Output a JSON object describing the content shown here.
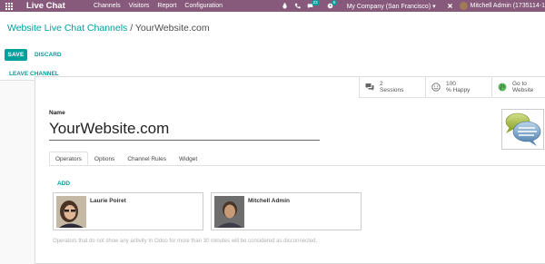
{
  "navbar": {
    "brand": "Live Chat",
    "menu": [
      "Channels",
      "Visitors",
      "Report",
      "Configuration"
    ],
    "messages_badge": "23",
    "activities_badge": "6",
    "company": "My Company (San Francisco)",
    "user": "Mitchell Admin (1735114-1"
  },
  "breadcrumb": {
    "parent": "Website Live Chat Channels",
    "separator": "/",
    "current": "YourWebsite.com"
  },
  "buttons": {
    "save": "SAVE",
    "discard": "DISCARD",
    "leave": "LEAVE CHANNEL"
  },
  "stats": [
    {
      "icon": "comments-icon",
      "line1": "2",
      "line2": "Sessions"
    },
    {
      "icon": "smile-icon",
      "line1": "100",
      "line2": "% Happy"
    },
    {
      "icon": "globe-icon",
      "line1": "Go to",
      "line2": "Website"
    }
  ],
  "form": {
    "name_label": "Name",
    "name_value": "YourWebsite.com"
  },
  "tabs": [
    "Operators",
    "Options",
    "Channel Rules",
    "Widget"
  ],
  "operators": {
    "add_label": "ADD",
    "list": [
      {
        "name": "Laurie Poiret"
      },
      {
        "name": "Mitchell Admin"
      }
    ],
    "help": "Operators that do not show any activity In Odoo for more than 30 minutes will be considered as disconnected."
  },
  "colors": {
    "navbar": "#875a7b",
    "accent": "#00a09d"
  }
}
